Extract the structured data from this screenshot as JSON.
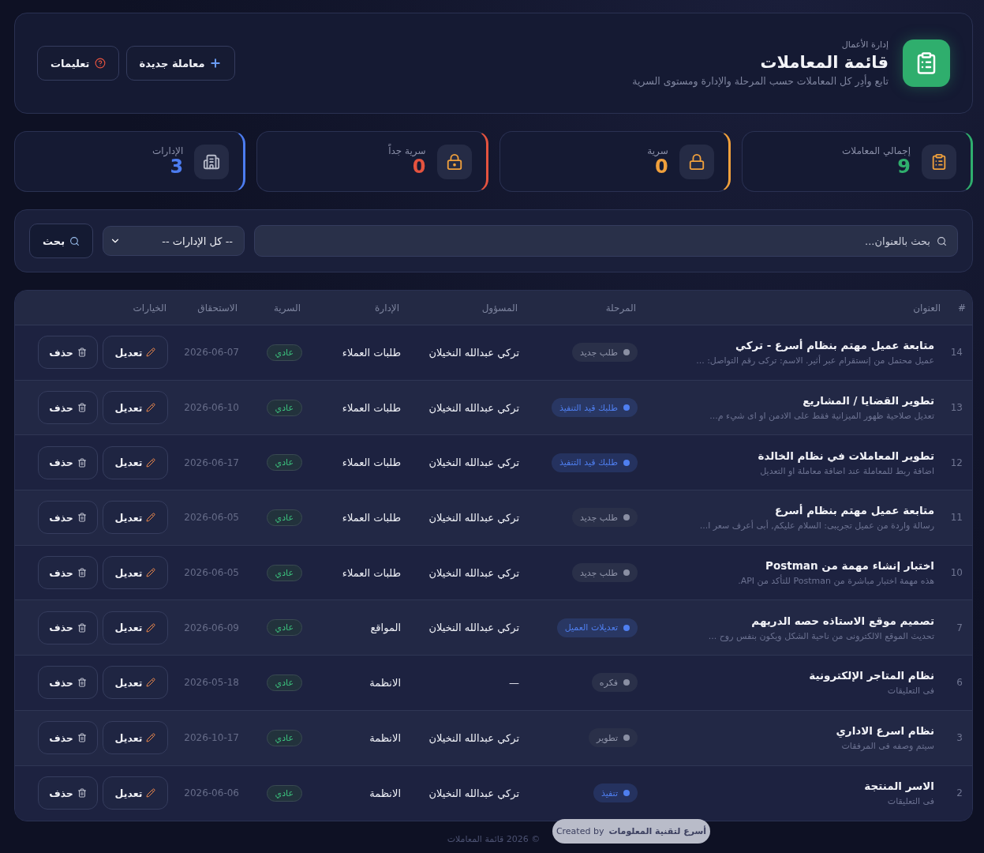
{
  "header": {
    "eyebrow": "إدارة الأعمال",
    "title": "قائمة المعاملات",
    "subtitle": "تابع وأدِر كل المعاملات حسب المرحلة والإدارة ومستوى السرية",
    "buttons": [
      {
        "kind": "new",
        "label": "معاملة جديدة"
      },
      {
        "kind": "help",
        "label": "تعليمات"
      }
    ]
  },
  "stats": [
    {
      "kind": "total",
      "label": "إجمالي المعاملات",
      "value": "9",
      "color": "#2fae6d"
    },
    {
      "kind": "secret",
      "label": "سرية",
      "value": "0",
      "color": "#f0a03c"
    },
    {
      "kind": "top_secret",
      "label": "سرية جداً",
      "value": "0",
      "color": "#e5533f"
    },
    {
      "kind": "departments",
      "label": "الإدارات",
      "value": "3",
      "color": "#4c7cf0"
    }
  ],
  "filters": {
    "search": {
      "placeholder": "بحث بالعنوان..."
    },
    "department": {
      "value": "-- كل الإدارات --"
    },
    "button": "بحث"
  },
  "table": {
    "columns": [
      "#",
      "العنوان",
      "المرحلة",
      "المسؤول",
      "الإدارة",
      "السرية",
      "الاستحقاق",
      "الخيارات"
    ],
    "rows": [
      {
        "num": "14",
        "title": "متابعة عميل مهتم بنظام أسرع - تركي",
        "desc": "عميل محتمل من إنستقرام عبر أثير. الاسم: تركى رقم التواصل: ...",
        "stage": {
          "label": "طلب جديد",
          "color": "#8a8fa3"
        },
        "owner": "تركي عبدالله النخيلان",
        "dept": "طلبات العملاء",
        "secrecy": "عادي",
        "due": "2026-06-07",
        "edit": "تعديل",
        "delete": "حذف"
      },
      {
        "num": "13",
        "title": "تطوير القضايا / المشاريع",
        "desc": "تعديل صلاحية ظهور الميزانية فقط على الادمن او اى شيء م...",
        "stage": {
          "label": "طلبك قيد التنفيذ",
          "color": "#4f7ff0"
        },
        "owner": "تركي عبدالله النخيلان",
        "dept": "طلبات العملاء",
        "secrecy": "عادي",
        "due": "2026-06-10",
        "edit": "تعديل",
        "delete": "حذف"
      },
      {
        "num": "12",
        "title": "تطوير المعاملات في نظام الخالدة",
        "desc": "اضافة ربط للمعاملة عند اضافة معاملة او التعديل",
        "stage": {
          "label": "طلبك قيد التنفيذ",
          "color": "#4f7ff0"
        },
        "owner": "تركي عبدالله النخيلان",
        "dept": "طلبات العملاء",
        "secrecy": "عادي",
        "due": "2026-06-17",
        "edit": "تعديل",
        "delete": "حذف"
      },
      {
        "num": "11",
        "title": "متابعة عميل مهتم بنظام أسرع",
        "desc": "رسالة واردة من عميل تجريبى: السلام عليكم, أبى أعرف سعر ا...",
        "stage": {
          "label": "طلب جديد",
          "color": "#8a8fa3"
        },
        "owner": "تركي عبدالله النخيلان",
        "dept": "طلبات العملاء",
        "secrecy": "عادي",
        "due": "2026-06-05",
        "edit": "تعديل",
        "delete": "حذف"
      },
      {
        "num": "10",
        "title": "اختبار إنشاء مهمة من Postman",
        "desc": "هذه مهمة اختبار مباشرة من Postman للتأكد من API.",
        "stage": {
          "label": "طلب جديد",
          "color": "#8a8fa3"
        },
        "owner": "تركي عبدالله النخيلان",
        "dept": "طلبات العملاء",
        "secrecy": "عادي",
        "due": "2026-06-05",
        "edit": "تعديل",
        "delete": "حذف"
      },
      {
        "num": "7",
        "title": "تصميم موقع الاستاذه حصه الدريهم",
        "desc": "تحديث الموقع الالكترونى من ناحية الشكل ويكون بنفس روح ...",
        "stage": {
          "label": "تعديلات العميل",
          "color": "#4f7ff0"
        },
        "owner": "تركي عبدالله النخيلان",
        "dept": "المواقع",
        "secrecy": "عادي",
        "due": "2026-06-09",
        "edit": "تعديل",
        "delete": "حذف"
      },
      {
        "num": "6",
        "title": "نظام المتاجر الإلكترونية",
        "desc": "فى التعليقات",
        "stage": {
          "label": "فكره",
          "color": "#8a8fa3"
        },
        "owner": "—",
        "dept": "الانظمة",
        "secrecy": "عادي",
        "due": "2026-05-18",
        "edit": "تعديل",
        "delete": "حذف"
      },
      {
        "num": "3",
        "title": "نظام اسرع الاداري",
        "desc": "سيتم وصفه فى المرفقات",
        "stage": {
          "label": "تطوير",
          "color": "#8a8fa3"
        },
        "owner": "تركي عبدالله النخيلان",
        "dept": "الانظمة",
        "secrecy": "عادي",
        "due": "2026-10-17",
        "edit": "تعديل",
        "delete": "حذف"
      },
      {
        "num": "2",
        "title": "الاسر المنتجة",
        "desc": "فى التعليقات",
        "stage": {
          "label": "تنفيذ",
          "color": "#4f7ff0"
        },
        "owner": "تركي عبدالله النخيلان",
        "dept": "الانظمة",
        "secrecy": "عادي",
        "due": "2026-06-06",
        "edit": "تعديل",
        "delete": "حذف"
      }
    ]
  },
  "footer": {
    "copyright": "© 2026 قائمة المعاملات",
    "credit_prefix": "Created by",
    "credit_name": "أسرع لتقنية المعلومات"
  }
}
